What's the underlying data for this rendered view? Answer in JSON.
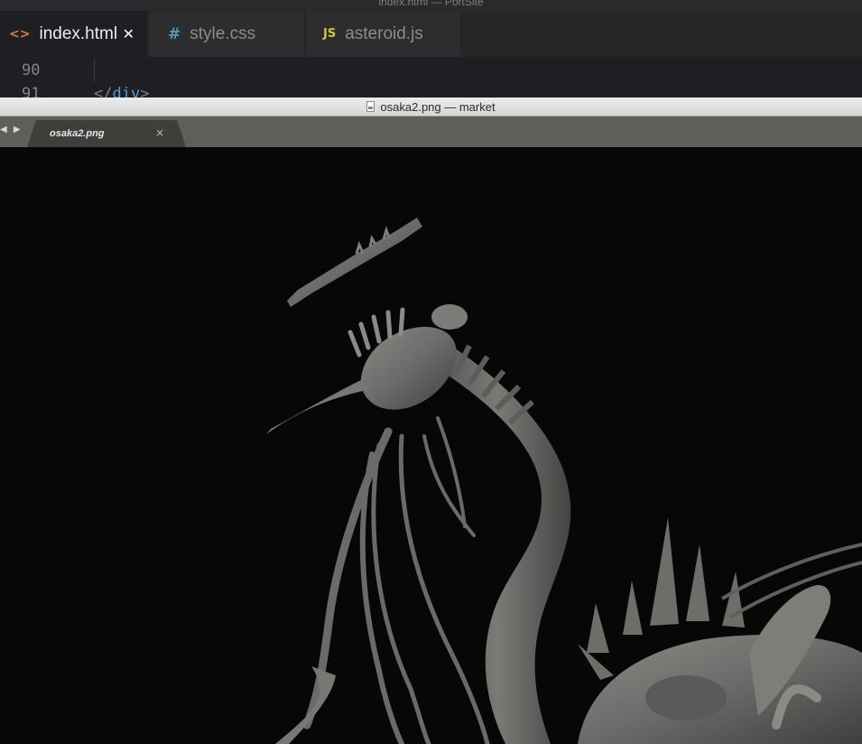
{
  "editor": {
    "window_title": "index.html — PortSite",
    "tabs": [
      {
        "label": "index.html",
        "icon": "html-file-icon",
        "glyph": "<>",
        "active": true,
        "close": "✕"
      },
      {
        "label": "style.css",
        "icon": "css-file-icon",
        "glyph": "#",
        "active": false
      },
      {
        "label": "asteroid.js",
        "icon": "js-file-icon",
        "glyph": "JS",
        "active": false
      }
    ],
    "lines": [
      {
        "number": "90",
        "code": ""
      },
      {
        "number": "91",
        "code_open": "</",
        "code_tag": "div",
        "code_close": ">"
      }
    ]
  },
  "viewer": {
    "window_title": "osaka2.png — market",
    "nav": {
      "back": "◀",
      "forward": "▶"
    },
    "tab": {
      "label": "osaka2.png",
      "close": "×"
    },
    "image": {
      "subject": "grey 3D sculpt of a creature with long neck, tentacles and spiked body",
      "background": "#070707"
    }
  },
  "colors": {
    "editor_bg": "#1e1f22",
    "viewer_tabbar": "#5e5e5b",
    "sculpt_base": "#6b6b69"
  }
}
